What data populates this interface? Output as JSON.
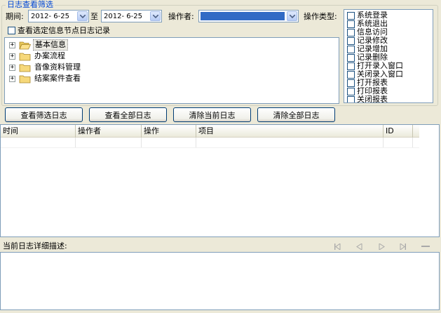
{
  "filter_group": {
    "title": "日志查看筛选",
    "period_label": "期间:",
    "date_from": "2012- 6-25",
    "to_label": "至",
    "date_to": "2012- 6-25",
    "operator_label": "操作者:",
    "operator_value": "",
    "optype_label": "操作类型:",
    "view_selected_label": "查看选定信息节点日志记录",
    "tree": [
      {
        "label": "基本信息",
        "selected": true
      },
      {
        "label": "办案流程",
        "selected": false
      },
      {
        "label": "音像资料管理",
        "selected": false
      },
      {
        "label": "结案案件查看",
        "selected": false
      }
    ],
    "op_types": [
      "系统登录",
      "系统退出",
      "信息访问",
      "记录修改",
      "记录增加",
      "记录删除",
      "打开录入窗口",
      "关闭录入窗口",
      "打开报表",
      "打印报表",
      "关闭报表"
    ]
  },
  "actions": {
    "view_filtered": "查看筛选日志",
    "view_all": "查看全部日志",
    "clear_current": "清除当前日志",
    "clear_all": "清除全部日志"
  },
  "log_table": {
    "columns": [
      "时间",
      "操作者",
      "操作",
      "项目",
      "ID"
    ]
  },
  "detail": {
    "label": "当前日志详细描述:"
  },
  "navigator": [
    "first-icon",
    "prev-icon",
    "next-icon",
    "last-icon",
    "delete-icon"
  ]
}
